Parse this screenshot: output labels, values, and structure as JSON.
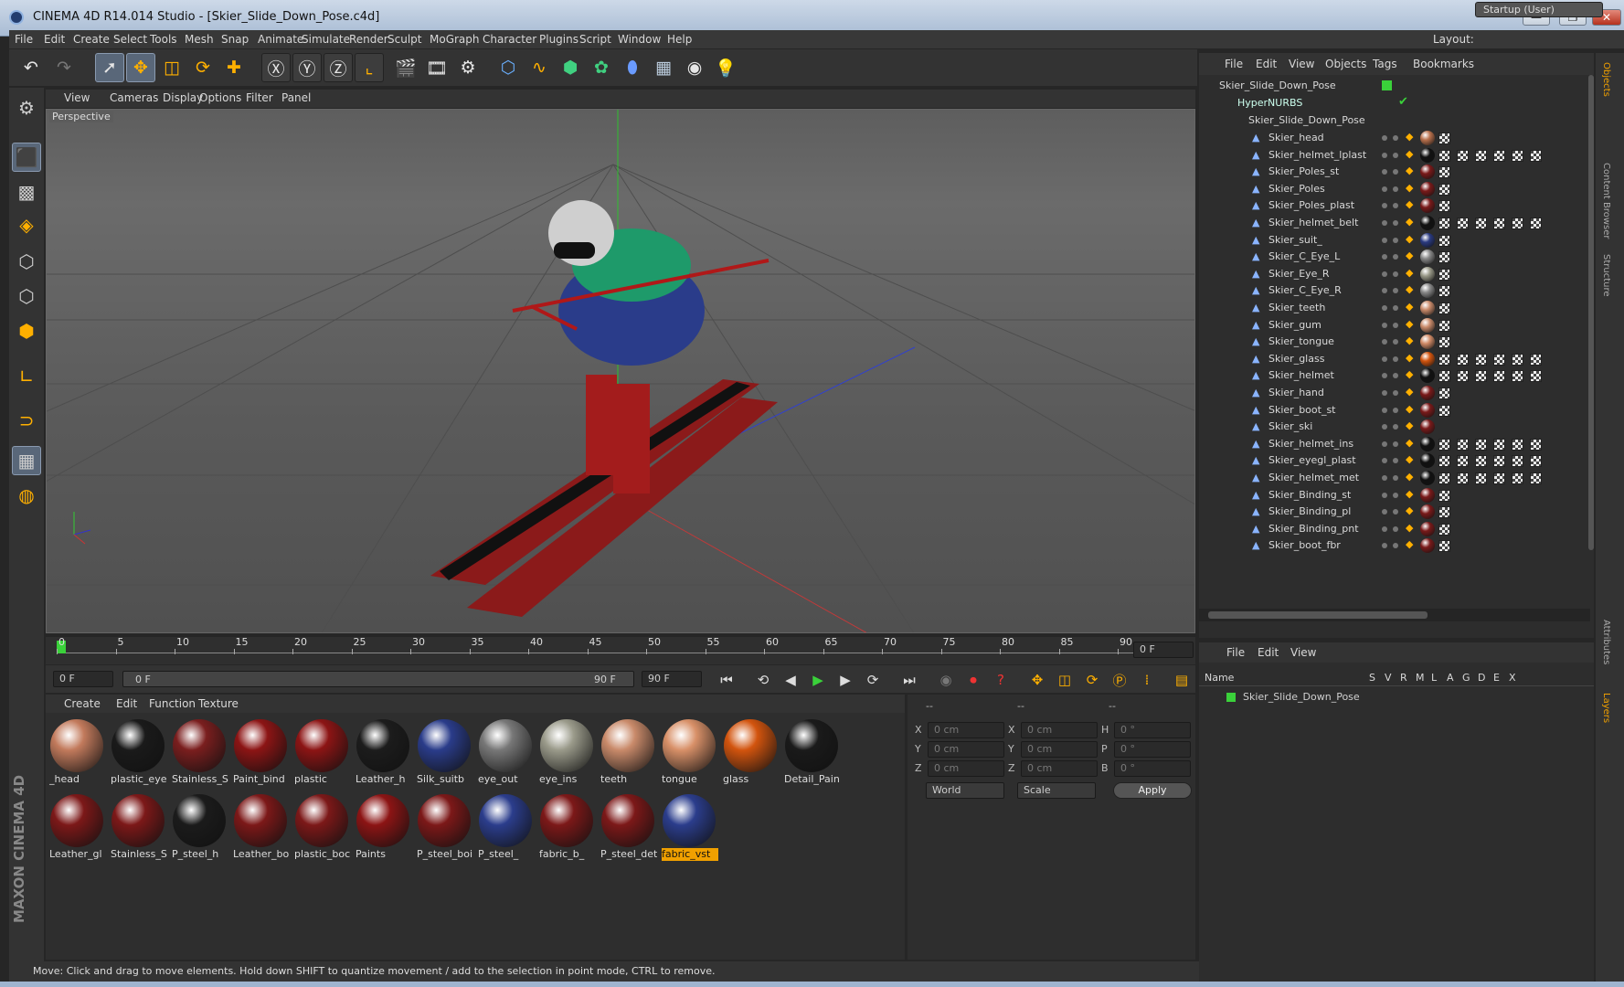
{
  "window": {
    "title": "CINEMA 4D R14.014 Studio - [Skier_Slide_Down_Pose.c4d]",
    "min": "—",
    "max": "❐",
    "close": "✕"
  },
  "menu": {
    "items": [
      "File",
      "Edit",
      "Create",
      "Select",
      "Tools",
      "Mesh",
      "Snap",
      "Animate",
      "Simulate",
      "Render",
      "Sculpt",
      "MoGraph",
      "Character",
      "Plugins",
      "Script",
      "Window",
      "Help"
    ],
    "layout_label": "Layout:",
    "layout_value": "Startup (User)"
  },
  "viewport": {
    "menu": [
      "View",
      "Cameras",
      "Display",
      "Options",
      "Filter",
      "Panel"
    ],
    "label": "Perspective"
  },
  "timeline": {
    "ticks": [
      "0",
      "5",
      "10",
      "15",
      "20",
      "25",
      "30",
      "35",
      "40",
      "45",
      "50",
      "55",
      "60",
      "65",
      "70",
      "75",
      "80",
      "85",
      "90"
    ],
    "current": "0 F"
  },
  "playbar": {
    "start": "0 F",
    "range_start": "0 F",
    "range_end": "90 F",
    "end": "90 F"
  },
  "materials": {
    "menu": [
      "Create",
      "Edit",
      "Function",
      "Texture"
    ],
    "row1": [
      {
        "name": "_head",
        "color": "#c27a5c"
      },
      {
        "name": "plastic_eye",
        "color": "#1a1a1a"
      },
      {
        "name": "Stainless_S",
        "color": "#7a1e1e"
      },
      {
        "name": "Paint_bind",
        "color": "#8c1414"
      },
      {
        "name": "plastic",
        "color": "#8c1414"
      },
      {
        "name": "Leather_h",
        "color": "#1c1c1c"
      },
      {
        "name": "Silk_suitb",
        "color": "#2a3c8a"
      },
      {
        "name": "eye_out",
        "color": "#777777"
      },
      {
        "name": "eye_ins",
        "color": "#9a9a8a"
      },
      {
        "name": "teeth",
        "color": "#c98a6a"
      },
      {
        "name": "tongue",
        "color": "#d89068"
      },
      {
        "name": "glass",
        "color": "#d2540e"
      },
      {
        "name": "Detail_Pain",
        "color": "#1a1a1a"
      }
    ],
    "row2": [
      {
        "name": "Leather_gl",
        "color": "#7c1818"
      },
      {
        "name": "Stainless_S",
        "color": "#7c1818"
      },
      {
        "name": "P_steel_h",
        "color": "#1b1b1b"
      },
      {
        "name": "Leather_bo",
        "color": "#7c1818"
      },
      {
        "name": "plastic_boc",
        "color": "#7c1818"
      },
      {
        "name": "Paints",
        "color": "#8c1414"
      },
      {
        "name": "P_steel_boi",
        "color": "#7c1818"
      },
      {
        "name": "P_steel_",
        "color": "#2b3d8c"
      },
      {
        "name": "fabric_b_",
        "color": "#7c1818"
      },
      {
        "name": "P_steel_det",
        "color": "#7c1818"
      },
      {
        "name": "fabric_vst",
        "color": "#2b3d8c"
      }
    ]
  },
  "coords": {
    "headers": [
      "--",
      "--",
      "--"
    ],
    "rows": [
      {
        "a": "X",
        "av": "0 cm",
        "b": "X",
        "bv": "0 cm",
        "c": "H",
        "cv": "0 °"
      },
      {
        "a": "Y",
        "av": "0 cm",
        "b": "Y",
        "bv": "0 cm",
        "c": "P",
        "cv": "0 °"
      },
      {
        "a": "Z",
        "av": "0 cm",
        "b": "Z",
        "bv": "0 cm",
        "c": "B",
        "cv": "0 °"
      }
    ],
    "mode": "World",
    "scale": "Scale",
    "apply": "Apply"
  },
  "objects": {
    "menu": [
      "File",
      "Edit",
      "View",
      "Objects",
      "Tags",
      "Bookmarks"
    ],
    "root": "Skier_Slide_Down_Pose",
    "nurbs": "HyperNURBS",
    "group": "Skier_Slide_Down_Pose",
    "items": [
      {
        "name": "Skier_head",
        "tag": "#b8704c",
        "checks": 1
      },
      {
        "name": "Skier_helmet_lplast",
        "tag": "#111111",
        "checks": 6
      },
      {
        "name": "Skier_Poles_st",
        "tag": "#7a1a1a",
        "checks": 1
      },
      {
        "name": "Skier_Poles",
        "tag": "#7a1a1a",
        "checks": 1
      },
      {
        "name": "Skier_Poles_plast",
        "tag": "#7a1a1a",
        "checks": 1
      },
      {
        "name": "Skier_helmet_belt",
        "tag": "#111111",
        "checks": 6
      },
      {
        "name": "Skier_suit_",
        "tag": "#2a3a80",
        "checks": 1
      },
      {
        "name": "Skier_C_Eye_L",
        "tag": "#888888",
        "checks": 1
      },
      {
        "name": "Skier_Eye_R",
        "tag": "#999988",
        "checks": 1
      },
      {
        "name": "Skier_C_Eye_R",
        "tag": "#888888",
        "checks": 1
      },
      {
        "name": "Skier_teeth",
        "tag": "#c98a6a",
        "checks": 1
      },
      {
        "name": "Skier_gum",
        "tag": "#c98a6a",
        "checks": 1
      },
      {
        "name": "Skier_tongue",
        "tag": "#d08a66",
        "checks": 1
      },
      {
        "name": "Skier_glass",
        "tag": "#d2540e",
        "checks": 6
      },
      {
        "name": "Skier_helmet",
        "tag": "#111111",
        "checks": 6
      },
      {
        "name": "Skier_hand",
        "tag": "#7a1a1a",
        "checks": 1
      },
      {
        "name": "Skier_boot_st",
        "tag": "#7a1a1a",
        "checks": 1
      },
      {
        "name": "Skier_ski",
        "tag": "#7a1a1a",
        "checks": 0
      },
      {
        "name": "Skier_helmet_ins",
        "tag": "#111111",
        "checks": 6
      },
      {
        "name": "Skier_eyegl_plast",
        "tag": "#111111",
        "checks": 6
      },
      {
        "name": "Skier_helmet_met",
        "tag": "#111111",
        "checks": 6
      },
      {
        "name": "Skier_Binding_st",
        "tag": "#7a1a1a",
        "checks": 1
      },
      {
        "name": "Skier_Binding_pl",
        "tag": "#7a1a1a",
        "checks": 1
      },
      {
        "name": "Skier_Binding_pnt",
        "tag": "#7a1a1a",
        "checks": 1
      },
      {
        "name": "Skier_boot_fbr",
        "tag": "#7a1a1a",
        "checks": 1
      }
    ]
  },
  "layers": {
    "menu": [
      "File",
      "Edit",
      "View"
    ],
    "cols": [
      "Name",
      "S",
      "V",
      "R",
      "M",
      "L",
      "A",
      "G",
      "D",
      "E",
      "X"
    ],
    "row": "Skier_Slide_Down_Pose"
  },
  "sidetabs": [
    "Objects",
    "Content Browser",
    "Structure",
    "Attributes",
    "Layers"
  ],
  "status": "Move: Click and drag to move elements. Hold down SHIFT to quantize movement / add to the selection in point mode, CTRL to remove.",
  "brand": "MAXON CINEMA 4D"
}
